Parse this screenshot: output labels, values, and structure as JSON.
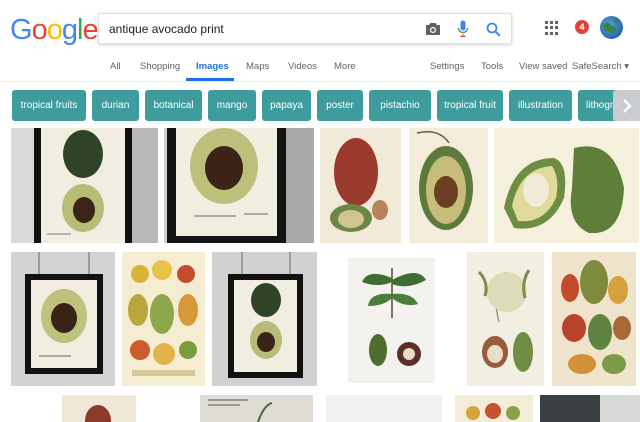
{
  "logo": {
    "letters": [
      "G",
      "o",
      "o",
      "g",
      "l",
      "e"
    ],
    "colors": [
      "#4285f4",
      "#ea4335",
      "#fbbc05",
      "#4285f4",
      "#34a853",
      "#ea4335"
    ]
  },
  "search": {
    "query": "antique avocado print"
  },
  "header": {
    "notification_count": "4"
  },
  "nav": {
    "tabs": [
      "All",
      "Shopping",
      "Images",
      "Maps",
      "Videos",
      "More"
    ],
    "active": "Images",
    "settings": "Settings",
    "tools": "Tools",
    "view_saved": "View saved",
    "safesearch": "SafeSearch ▾"
  },
  "chips": [
    "tropical fruits",
    "durian",
    "botanical",
    "mango",
    "papaya",
    "poster",
    "pistachio",
    "tropical fruit",
    "illustration",
    "lithograph"
  ],
  "colors": {
    "chip": "#3e9c9c",
    "accent": "#1a73e8"
  }
}
